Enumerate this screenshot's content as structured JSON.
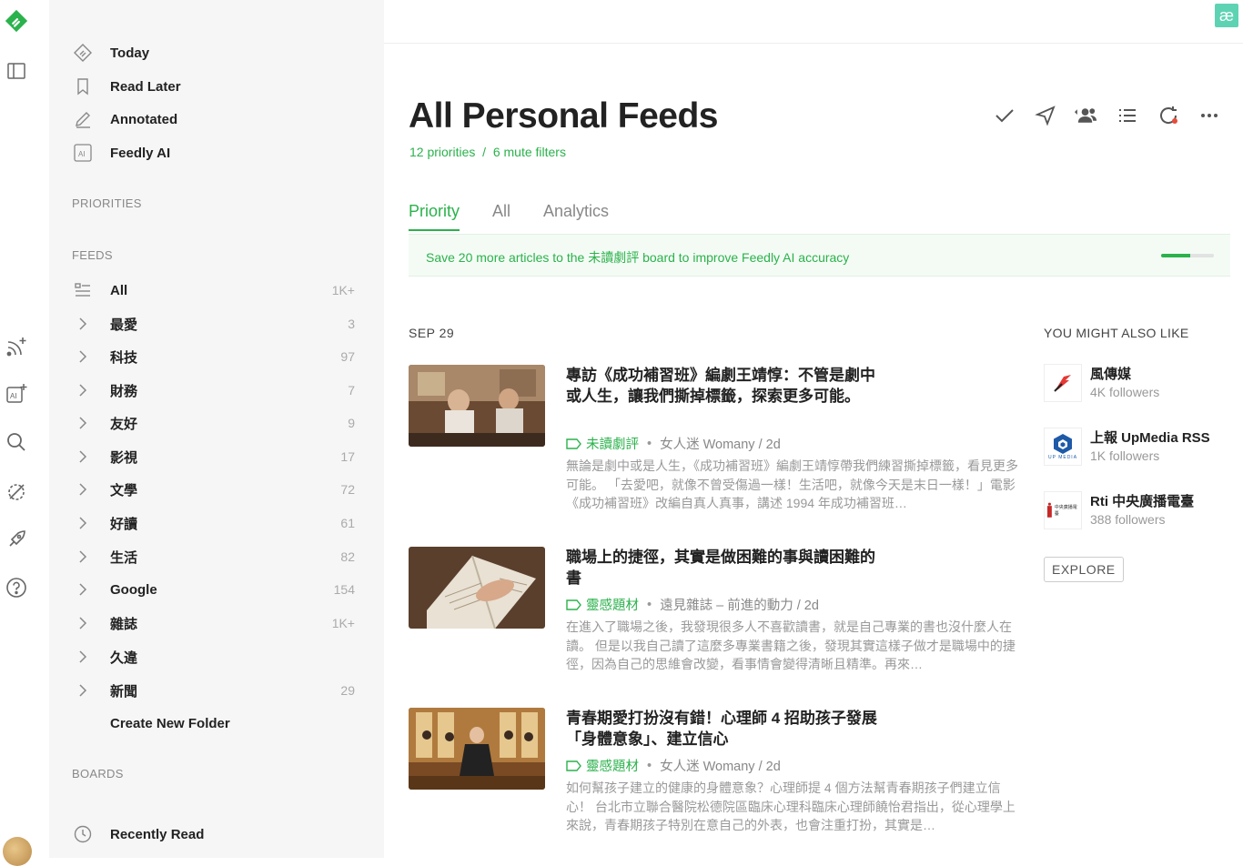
{
  "rail": {
    "icons": [
      "feedly-logo-icon",
      "sidebar-toggle-icon",
      "follow-sources-icon",
      "ai-feed-icon",
      "search-icon",
      "mute-icon",
      "rocket-icon",
      "help-icon"
    ]
  },
  "sidebar": {
    "top_items": [
      {
        "label": "Today",
        "icon": "today-icon"
      },
      {
        "label": "Read Later",
        "icon": "bookmark-icon"
      },
      {
        "label": "Annotated",
        "icon": "pen-icon"
      },
      {
        "label": "Feedly AI",
        "icon": "ai-icon"
      }
    ],
    "priorities_heading": "PRIORITIES",
    "feeds_heading": "FEEDS",
    "feeds": [
      {
        "label": "All",
        "count": "1K+"
      },
      {
        "label": "最愛",
        "count": "3"
      },
      {
        "label": "科技",
        "count": "97"
      },
      {
        "label": "財務",
        "count": "7"
      },
      {
        "label": "友好",
        "count": "9"
      },
      {
        "label": "影視",
        "count": "17"
      },
      {
        "label": "文學",
        "count": "72"
      },
      {
        "label": "好讀",
        "count": "61"
      },
      {
        "label": "生活",
        "count": "82"
      },
      {
        "label": "Google",
        "count": "154"
      },
      {
        "label": "雜誌",
        "count": "1K+"
      },
      {
        "label": "久違",
        "count": ""
      },
      {
        "label": "新聞",
        "count": "29"
      }
    ],
    "create_folder": "Create New Folder",
    "boards_heading": "BOARDS",
    "boards": [
      {
        "label": "Recently Read",
        "icon": "clock-icon"
      }
    ]
  },
  "header": {
    "logo_text": "æ",
    "title": "All Personal Feeds",
    "subtitle": "12 priorities  /  6 mute filters"
  },
  "tabs": [
    {
      "label": "Priority",
      "active": true
    },
    {
      "label": "All",
      "active": false
    },
    {
      "label": "Analytics",
      "active": false
    }
  ],
  "banner": {
    "text": "Save 20 more articles to the 未讀劇評 board to improve Feedly AI accuracy",
    "progress": 0.55
  },
  "date_heading": "SEP 29",
  "articles": [
    {
      "title": "專訪《成功補習班》編劇王靖惇：不管是劇中或人生，讓我們撕掉標籤，探索更多可能。",
      "tag": "未讀劇評",
      "source": "女人迷 Womany / 2d",
      "summary": "無論是劇中或是人生，《成功補習班》編劇王靖惇帶我們練習撕掉標籤，看見更多可能。 「去愛吧，就像不曾受傷過一樣！生活吧，就像今天是末日一樣！」電影《成功補習班》改編自真人真事，講述 1994 年成功補習班…"
    },
    {
      "title": "職場上的捷徑，其實是做困難的事與讀困難的書",
      "tag": "靈感題材",
      "source": "遠見雜誌 – 前進的動力 / 2d",
      "summary": "在進入了職場之後，我發現很多人不喜歡讀書，就是自己專業的書也沒什麼人在讀。 但是以我自己讀了這麼多專業書籍之後，發現其實這樣子做才是職場中的捷徑，因為自己的思維會改變，看事情會變得清晰且精準。再來…"
    },
    {
      "title": "青春期愛打扮沒有錯！心理師 4 招助孩子發展「身體意象」、建立信心",
      "tag": "靈感題材",
      "source": "女人迷 Womany / 2d",
      "summary": "如何幫孩子建立的健康的身體意象？心理師提 4 個方法幫青春期孩子們建立信心！ 台北市立聯合醫院松德院區臨床心理科臨床心理師饒怡君指出，從心理學上來說，青春期孩子特別在意自己的外表，也會注重打扮，其實是…"
    }
  ],
  "suggestions": {
    "heading": "YOU MIGHT ALSO LIKE",
    "items": [
      {
        "name": "風傳媒",
        "followers": "4K followers"
      },
      {
        "name": "上報 UpMedia RSS",
        "followers": "1K followers",
        "logo_caption": "UP MEDIA"
      },
      {
        "name": "Rti 中央廣播電臺",
        "followers": "388 followers",
        "logo_caption": "中央廣播電臺"
      }
    ],
    "explore_label": "EXPLORE"
  },
  "colors": {
    "accent": "#2bb24c",
    "sidebar_bg": "#f6f6f6",
    "banner_bg": "#f4fbf5",
    "ae_logo": "#5ed3b4"
  }
}
